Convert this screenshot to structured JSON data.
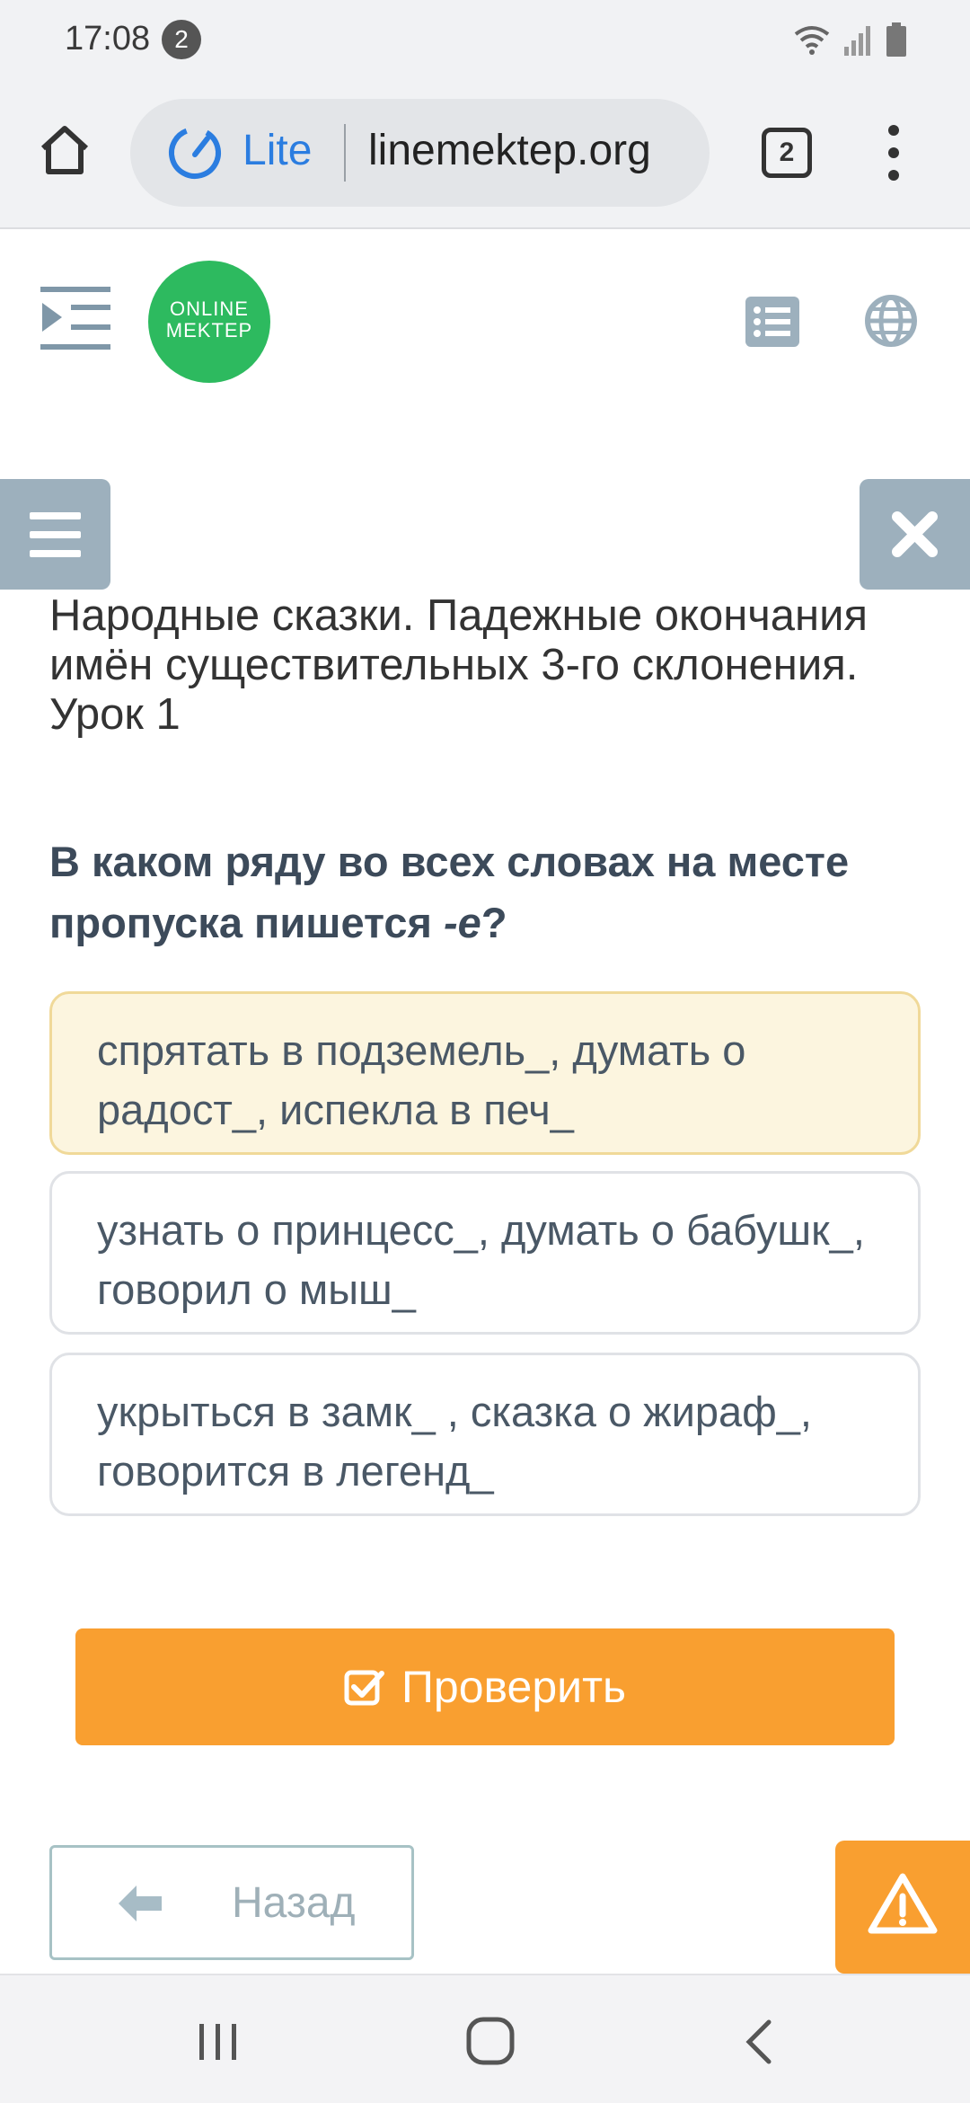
{
  "status_bar": {
    "time": "17:08",
    "notification_count": "2"
  },
  "browser": {
    "mode_label": "Lite",
    "url": "linemektep.org",
    "tab_count": "2",
    "accent_color": "#2b7de0"
  },
  "header": {
    "logo_line1": "ONLINE",
    "logo_line2": "MEKTEP",
    "brand_color": "#2dba5f"
  },
  "lesson": {
    "title": "Народные сказки. Падежные окончания имён существительных 3-го склонения. Урок 1"
  },
  "question": {
    "text_before": "В каком ряду во всех словах на месте пропуска пишется ",
    "emphasis": "-е",
    "text_after": "?"
  },
  "options": [
    {
      "text": "спрятать в подземель_, думать о радост_, испекла в печ_",
      "selected": true
    },
    {
      "text": "узнать о принцесс_, думать о бабушк_, говорил о мыш_",
      "selected": false
    },
    {
      "text": "укрыться в замк_ , сказка о жираф_, говорится в легенд_",
      "selected": false
    }
  ],
  "actions": {
    "check_label": "Проверить",
    "back_label": "Назад",
    "accent_color": "#f99f30"
  },
  "icons": {
    "home": "home-icon",
    "lite": "speedometer-icon",
    "menu": "more-vert-icon",
    "indent": "sidebar-indent-icon",
    "list": "list-icon",
    "globe": "globe-icon",
    "side_menu": "hamburger-icon",
    "close": "close-icon",
    "check": "checkbox-icon",
    "back": "arrow-left-icon",
    "report": "warning-icon"
  }
}
